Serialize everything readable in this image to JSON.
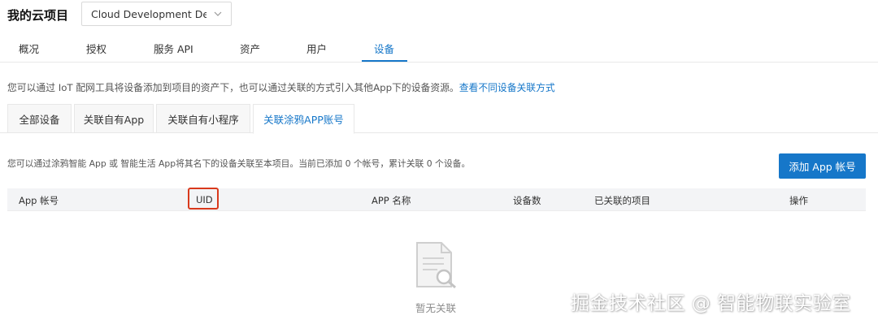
{
  "header": {
    "app_title": "我的云项目",
    "project_select": "Cloud Development De..."
  },
  "nav": {
    "tabs": [
      {
        "label": "概况"
      },
      {
        "label": "授权"
      },
      {
        "label": "服务 API"
      },
      {
        "label": "资产"
      },
      {
        "label": "用户"
      },
      {
        "label": "设备"
      }
    ],
    "active": "设备"
  },
  "intro": {
    "text": "您可以通过 IoT 配网工具将设备添加到项目的资产下，也可以通过关联的方式引入其他App下的设备资源。",
    "link": "查看不同设备关联方式"
  },
  "sub_tabs": {
    "tabs": [
      {
        "label": "全部设备"
      },
      {
        "label": "关联自有App"
      },
      {
        "label": "关联自有小程序"
      },
      {
        "label": "关联涂鸦APP账号"
      }
    ],
    "active": "关联涂鸦APP账号"
  },
  "panel": {
    "description": "您可以通过涂鸦智能 App 或 智能生活 App将其名下的设备关联至本项目。当前已添加 0 个帐号，累计关联 0 个设备。",
    "add_button": "添加 App 帐号"
  },
  "table": {
    "columns": [
      "App 帐号",
      "UID",
      "APP 名称",
      "设备数",
      "已关联的项目",
      "操作"
    ],
    "highlighted_column": "UID",
    "highlight_color": "#d9391c",
    "empty_text": "暂无关联",
    "empty_icon": "document-search-icon"
  },
  "watermark": "掘金技术社区 @ 智能物联实验室",
  "colors": {
    "accent": "#1677c9",
    "highlight": "#d9391c"
  }
}
